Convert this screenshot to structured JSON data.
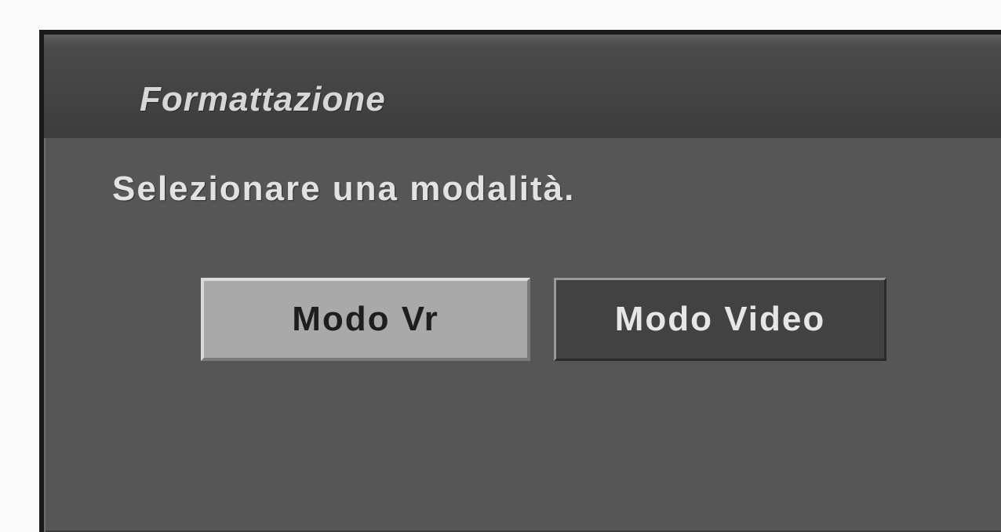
{
  "dialog": {
    "title": "Formattazione",
    "prompt": "Selezionare una modalità.",
    "options": [
      {
        "label": "Modo Vr",
        "selected": true
      },
      {
        "label": "Modo Video",
        "selected": false
      }
    ]
  },
  "colors": {
    "panel": "#565656",
    "title_bar": "#3d3d3d",
    "selected_button": "#a9a9a9",
    "normal_button": "#424242"
  }
}
